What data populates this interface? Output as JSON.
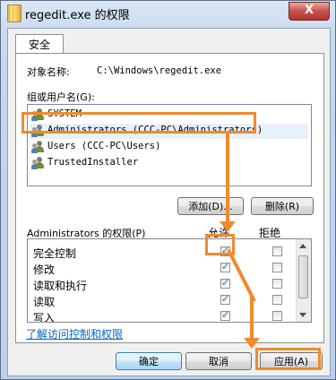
{
  "window": {
    "title": "regedit.exe 的权限",
    "close_label": "X"
  },
  "tabs": [
    {
      "label": "安全"
    }
  ],
  "object": {
    "label": "对象名称:",
    "value": "C:\\Windows\\regedit.exe"
  },
  "groups": {
    "label": "组或用户名(G):",
    "items": [
      {
        "name": "SYSTEM"
      },
      {
        "name": "Administrators (CCC-PC\\Administrators)"
      },
      {
        "name": "Users (CCC-PC\\Users)"
      },
      {
        "name": "TrustedInstaller"
      }
    ],
    "selected_index": 1
  },
  "group_buttons": {
    "add": "添加(D)...",
    "remove": "删除(R)"
  },
  "permissions": {
    "label": "Administrators 的权限(P)",
    "allow_header": "允许",
    "deny_header": "拒绝",
    "rows": [
      {
        "name": "完全控制",
        "allow": true,
        "deny": false
      },
      {
        "name": "修改",
        "allow": true,
        "deny": false
      },
      {
        "name": "读取和执行",
        "allow": true,
        "deny": false
      },
      {
        "name": "读取",
        "allow": true,
        "deny": false
      },
      {
        "name": "写入",
        "allow": true,
        "deny": false
      }
    ]
  },
  "help_link": "了解访问控制和权限",
  "footer": {
    "ok": "确定",
    "cancel": "取消",
    "apply": "应用(A)"
  },
  "colors": {
    "highlight": "#f08a2c",
    "link": "#0066cc"
  },
  "icons": {
    "window": "folder-icon",
    "user": "user-group-icon",
    "close": "close-icon"
  }
}
